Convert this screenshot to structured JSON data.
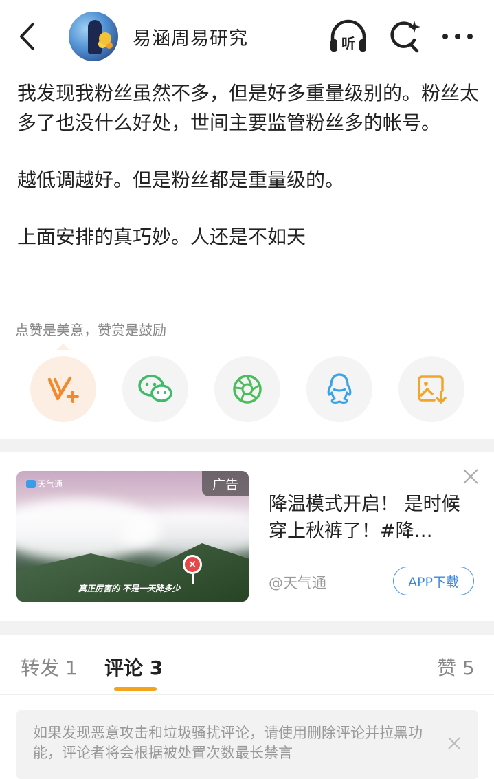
{
  "header": {
    "account_name": "易涵周易研究",
    "listen_label": "听"
  },
  "post": {
    "paragraphs": [
      "我发现我粉丝虽然不多，但是好多重量级别的。粉丝太多了也没什么好处，世间主要监管粉丝多的帐号。",
      "越低调越好。但是粉丝都是重量级的。",
      "上面安排的真巧妙。人还是不如天"
    ],
    "tip": "点赞是美意，赞赏是鼓励"
  },
  "share": {
    "buttons": [
      "v-plus-icon",
      "wechat-icon",
      "moments-icon",
      "qq-icon",
      "save-image-icon"
    ]
  },
  "ad": {
    "badge": "广告",
    "logo_text": "天气通",
    "caption": "真正厉害的 不是一天降多少",
    "title": "降温模式开启！ 是时候穿上秋裤了！#降…",
    "source": "@天气通",
    "download_label": "APP下载"
  },
  "tabs": {
    "repost": "转发 1",
    "comments": "评论 3",
    "likes": "赞 5"
  },
  "notice": {
    "text": "如果发现恶意攻击和垃圾骚扰评论，请使用删除评论并拉黑功能，评论者将会根据被处置次数最长禁言"
  },
  "colors": {
    "accent_orange": "#f4a31c",
    "link_blue": "#3a87e0"
  }
}
